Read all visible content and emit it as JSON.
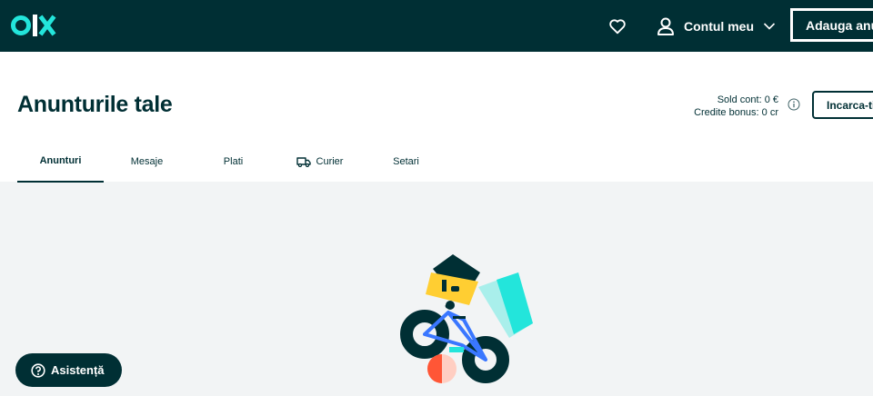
{
  "topbar": {
    "logo_text": "olx",
    "account_label": "Contul meu",
    "post_ad_label": "Adauga anunt"
  },
  "header": {
    "title": "Anunturile tale",
    "balance_line": "Sold cont: 0 €",
    "bonus_line": "Credite bonus: 0 cr",
    "topup_label": "Incarca-ti contul"
  },
  "tabs": [
    {
      "label": "Anunturi",
      "active": true
    },
    {
      "label": "Mesaje"
    },
    {
      "label": "Plati"
    },
    {
      "label": "Curier",
      "icon": "truck-icon"
    },
    {
      "label": "Setari"
    }
  ],
  "help": {
    "label": "Asistență"
  },
  "colors": {
    "brand_dark": "#002f34",
    "teal": "#23e5db",
    "yellow": "#ffce32",
    "blue": "#3a77ff",
    "red": "#ff5636",
    "background": "#f2f4f5"
  }
}
